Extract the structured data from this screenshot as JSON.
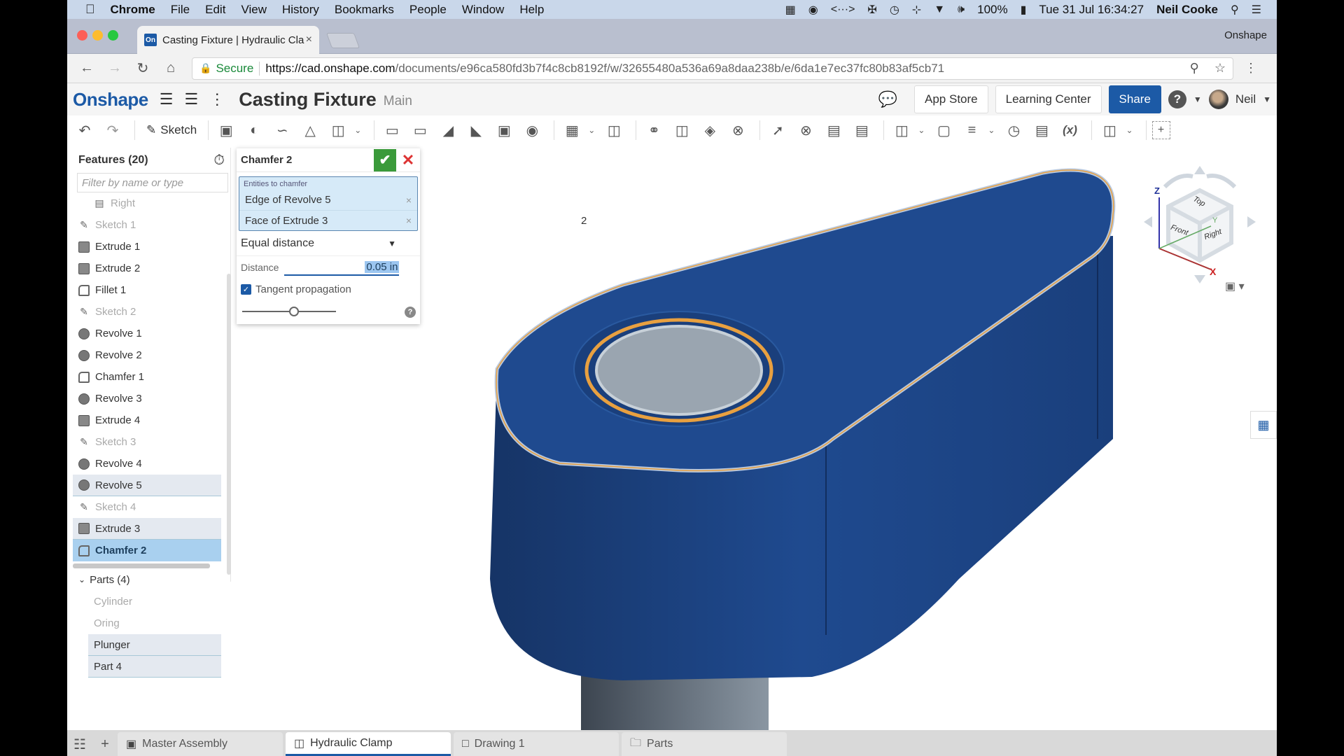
{
  "menubar": {
    "app": "Chrome",
    "items": [
      "File",
      "Edit",
      "View",
      "History",
      "Bookmarks",
      "People",
      "Window",
      "Help"
    ],
    "battery": "100%",
    "datetime": "Tue 31 Jul  16:34:27",
    "user": "Neil Cooke"
  },
  "browser": {
    "tab_title": "Casting Fixture | Hydraulic Cla",
    "favicon_text": "On",
    "profile_label": "Onshape",
    "secure_label": "Secure",
    "url_host": "https://cad.onshape.com",
    "url_path": "/documents/e96ca580fd3b7f4c8cb8192f/w/32655480a536a69a8daa238b/e/6da1e7ec37fc80b83af5cb71"
  },
  "header": {
    "logo": "Onshape",
    "doc_title": "Casting Fixture",
    "workspace": "Main",
    "app_store": "App Store",
    "learning_center": "Learning Center",
    "share": "Share",
    "user": "Neil"
  },
  "toolbar": {
    "sketch_label": "Sketch",
    "variable_label": "(x)"
  },
  "feature_tree": {
    "title": "Features (20)",
    "filter_placeholder": "Filter by name or type",
    "items": [
      {
        "label": "Right",
        "type": "plane",
        "state": "suppressed"
      },
      {
        "label": "Sketch 1",
        "type": "sketch",
        "state": "suppressed"
      },
      {
        "label": "Extrude 1",
        "type": "extrude",
        "state": "normal"
      },
      {
        "label": "Extrude 2",
        "type": "extrude",
        "state": "normal"
      },
      {
        "label": "Fillet 1",
        "type": "fillet",
        "state": "normal"
      },
      {
        "label": "Sketch 2",
        "type": "sketch",
        "state": "suppressed"
      },
      {
        "label": "Revolve 1",
        "type": "revolve",
        "state": "normal"
      },
      {
        "label": "Revolve 2",
        "type": "revolve",
        "state": "normal"
      },
      {
        "label": "Chamfer 1",
        "type": "chamfer",
        "state": "normal"
      },
      {
        "label": "Revolve 3",
        "type": "revolve",
        "state": "normal"
      },
      {
        "label": "Extrude 4",
        "type": "extrude",
        "state": "normal"
      },
      {
        "label": "Sketch 3",
        "type": "sketch",
        "state": "suppressed"
      },
      {
        "label": "Revolve 4",
        "type": "revolve",
        "state": "normal"
      },
      {
        "label": "Revolve 5",
        "type": "revolve",
        "state": "highlighted"
      },
      {
        "label": "Sketch 4",
        "type": "sketch",
        "state": "suppressed"
      },
      {
        "label": "Extrude 3",
        "type": "extrude",
        "state": "highlighted"
      },
      {
        "label": "Chamfer 2",
        "type": "chamfer",
        "state": "selected"
      }
    ],
    "parts_title": "Parts (4)",
    "parts": [
      {
        "label": "Cylinder",
        "state": "suppressed"
      },
      {
        "label": "Oring",
        "state": "suppressed"
      },
      {
        "label": "Plunger",
        "state": "highlighted"
      },
      {
        "label": "Part 4",
        "state": "highlighted"
      }
    ]
  },
  "dialog": {
    "title": "Chamfer 2",
    "entities_label": "Entities to chamfer",
    "entities": [
      "Edge of Revolve 5",
      "Face of Extrude 3"
    ],
    "type": "Equal distance",
    "distance_label": "Distance",
    "distance_value": "0.05 in",
    "tangent_label": "Tangent propagation",
    "tangent_checked": true,
    "slider_value": 0.55
  },
  "viewport": {
    "cursor_count": "2",
    "viewcube": {
      "top": "Top",
      "front": "Front",
      "right": "Right",
      "x": "X",
      "y": "Y",
      "z": "Z"
    },
    "colors": {
      "part": "#1f4a8f",
      "part_dark": "#17386e",
      "highlight": "#e8a040",
      "cylinder": "#5d6670",
      "hole": "#9aa5b0"
    }
  },
  "bottom_tabs": [
    {
      "label": "Master Assembly",
      "icon": "assembly-icon",
      "active": false
    },
    {
      "label": "Hydraulic Clamp",
      "icon": "partstudio-icon",
      "active": true
    },
    {
      "label": "Drawing 1",
      "icon": "drawing-icon",
      "active": false
    },
    {
      "label": "Parts",
      "icon": "folder-icon",
      "active": false
    }
  ]
}
